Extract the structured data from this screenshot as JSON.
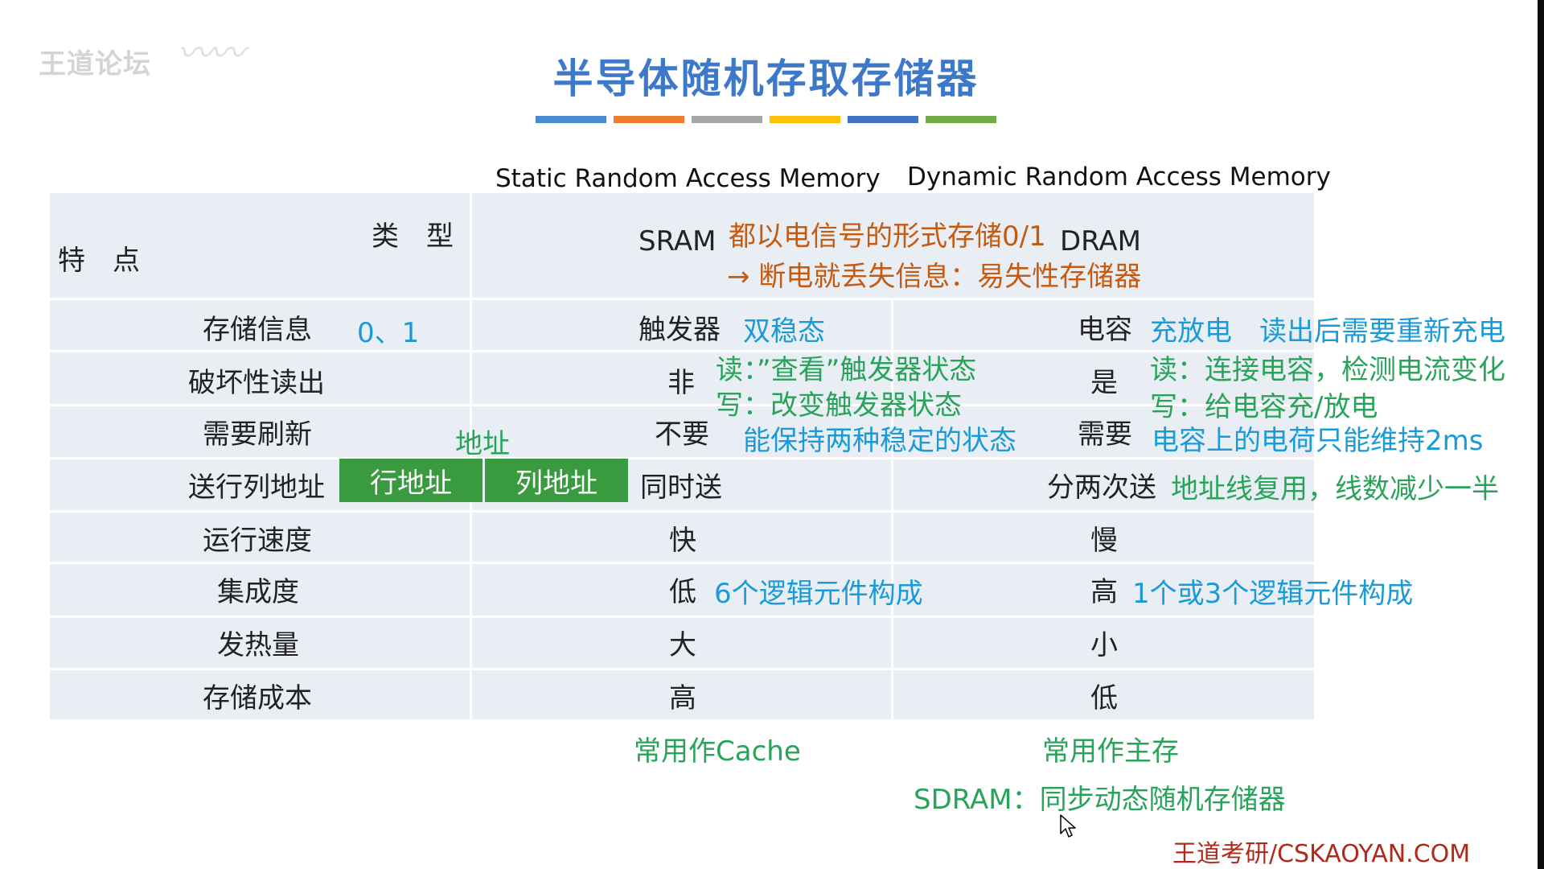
{
  "watermark": {
    "text": "王道论坛"
  },
  "title": "半导体随机存取存储器",
  "title_bar_colors": [
    "#4a8bd1",
    "#ed7d31",
    "#a5a5a5",
    "#ffc000",
    "#4472c4",
    "#70ad47"
  ],
  "colors": {
    "title": "#3d78c9",
    "blue_note": "#1a9ad6",
    "green_note": "#29a35a",
    "orange_note": "#c55a11",
    "table_bg": "#e9eef5",
    "address_box": "#3a9a40"
  },
  "headers": {
    "sram_fullname": "Static Random Access Memory",
    "dram_fullname": "Dynamic Random Access Memory",
    "type_label": "类　型",
    "feature_label": "特　点",
    "sram": "SRAM",
    "dram": "DRAM"
  },
  "common_notes": {
    "line1": "都以电信号的形式存储0/1",
    "line2": "→ 断电就丢失信息：易失性存储器"
  },
  "rows": [
    {
      "feature": "存储信息",
      "feature_note": "0、1",
      "sram": "触发器",
      "sram_note": "双稳态",
      "dram": "电容",
      "dram_note": "充放电　读出后需要重新充电"
    },
    {
      "feature": "破坏性读出",
      "sram": "非",
      "sram_note_1": "读：”查看”触发器状态",
      "sram_note_2": "写：改变触发器状态",
      "dram": "是",
      "dram_note_1": "读：连接电容，检测电流变化",
      "dram_note_2": "写：给电容充/放电"
    },
    {
      "feature": "需要刷新",
      "feature_note": "地址",
      "sram": "不要",
      "sram_note": "能保持两种稳定的状态",
      "dram": "需要",
      "dram_note": "电容上的电荷只能维持2ms"
    },
    {
      "feature": "送行列地址",
      "row_addr": "行地址",
      "col_addr": "列地址",
      "sram": "同时送",
      "dram": "分两次送",
      "dram_note": "地址线复用，线数减少一半"
    },
    {
      "feature": "运行速度",
      "sram": "快",
      "dram": "慢"
    },
    {
      "feature": "集成度",
      "sram": "低",
      "sram_note": "6个逻辑元件构成",
      "dram": "高",
      "dram_note": "1个或3个逻辑元件构成"
    },
    {
      "feature": "发热量",
      "sram": "大",
      "dram": "小"
    },
    {
      "feature": "存储成本",
      "sram": "高",
      "dram": "低"
    }
  ],
  "footer": {
    "sram_use": "常用作Cache",
    "dram_use": "常用作主存",
    "sdram": "SDRAM：同步动态随机存储器",
    "brand": "王道考研/CSKAOYAN.COM"
  },
  "cursor_icon": "arrow-cursor-icon"
}
